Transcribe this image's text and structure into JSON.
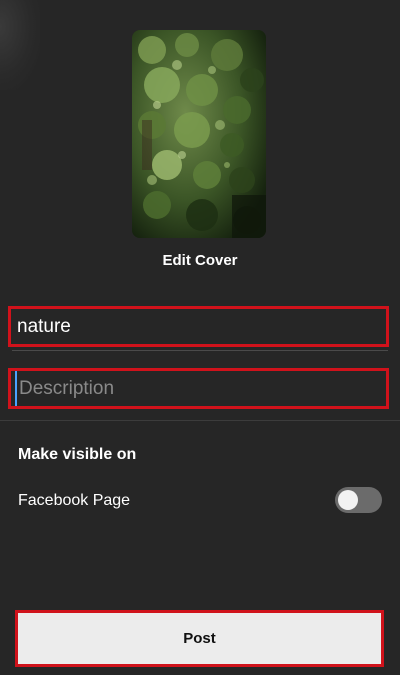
{
  "cover": {
    "edit_label": "Edit Cover"
  },
  "form": {
    "title_value": "nature",
    "description_placeholder": "Description"
  },
  "visibility": {
    "section_title": "Make visible on",
    "facebook_page_label": "Facebook Page",
    "facebook_page_enabled": false
  },
  "actions": {
    "post_label": "Post"
  },
  "colors": {
    "background": "#262626",
    "highlight_border": "#d0121b",
    "post_button_bg": "#ececec",
    "toggle_off": "#6b6b6b"
  }
}
